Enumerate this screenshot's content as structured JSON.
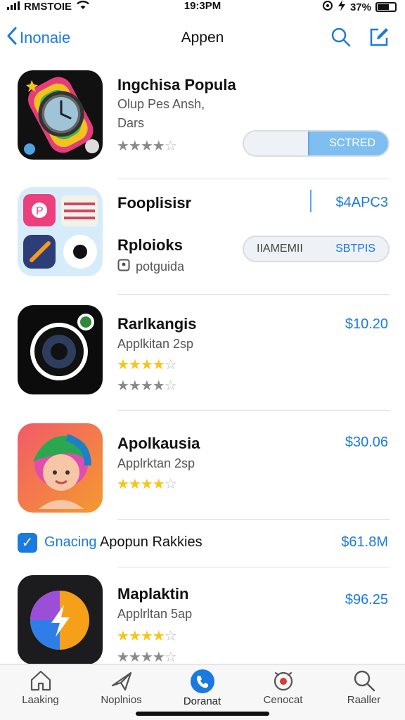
{
  "status_bar": {
    "carrier": "RMSTOIE",
    "time": "19:3PM",
    "battery": "37%"
  },
  "nav": {
    "back_label": "Inonaie",
    "title": "Appen"
  },
  "apps": [
    {
      "name": "Ingchisa Popula",
      "subtitle": "Olup Pes Ansh,",
      "subtitle2": "Dars",
      "segment": {
        "left": "",
        "right": "SCTRED"
      }
    },
    {
      "name": "Fooplisisr",
      "price": "$4APC3",
      "name2": "Rploioks",
      "subtitle": "potguida",
      "segment": {
        "left": "IIAMEMII",
        "right": "SBTPIS"
      }
    },
    {
      "name": "Rarlkangis",
      "subtitle": "Applkitan 2sp",
      "price": "$10.20"
    },
    {
      "name": "Apolkausia",
      "subtitle": "Applrktan 2sp",
      "price": "$30.06"
    },
    {
      "name": "Maplaktin",
      "subtitle": "Applrltan 5ap",
      "price": "$96.25"
    }
  ],
  "check_row": {
    "label_blue": "Gnacing",
    "label_black": "Apopun Rakkies",
    "price": "$61.8M"
  },
  "tabs": [
    {
      "label": "Laaking",
      "icon": "house-icon"
    },
    {
      "label": "Noplnios",
      "icon": "plane-icon"
    },
    {
      "label": "Doranat",
      "icon": "phone-icon"
    },
    {
      "label": "Cenocat",
      "icon": "alarm-icon"
    },
    {
      "label": "Raaller",
      "icon": "search-icon"
    }
  ],
  "colors": {
    "accent": "#1a7ae0",
    "star_gold": "#f5c518",
    "star_gray": "#8a8a8a"
  }
}
